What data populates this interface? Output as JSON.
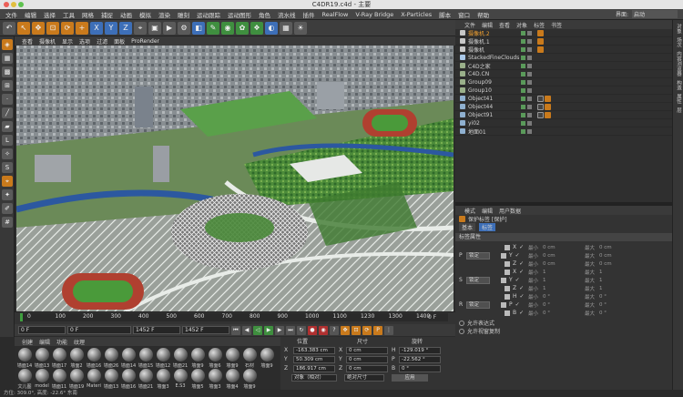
{
  "window": {
    "title": "C4DR19.c4d - 主要"
  },
  "menu": [
    "文件",
    "编辑",
    "选择",
    "工具",
    "网格",
    "捕捉",
    "动画",
    "模拟",
    "渲染",
    "雕刻",
    "运动跟踪",
    "运动图形",
    "角色",
    "流水线",
    "插件",
    "RealFlow",
    "V-Ray Bridge",
    "X-Particles",
    "脚本",
    "窗口",
    "帮助"
  ],
  "layout": {
    "label": "界面:",
    "value": "启动"
  },
  "viewport": {
    "menu": [
      "查看",
      "摄像机",
      "显示",
      "选项",
      "过滤",
      "面板",
      "ProRender"
    ]
  },
  "timeline": {
    "ticks": [
      "0",
      "100",
      "200",
      "300",
      "400",
      "500",
      "600",
      "700",
      "800",
      "900",
      "1000",
      "1100",
      "1230",
      "1300",
      "1400"
    ],
    "end_label": "0 F"
  },
  "transport": {
    "start": "0 F",
    "current": "0 F",
    "end1": "1452 F",
    "end2": "1452 F"
  },
  "materials": {
    "menu": [
      "创建",
      "编辑",
      "功能",
      "纹理"
    ],
    "items": [
      "墙面14",
      "墙面13",
      "墙面17",
      "墙面2",
      "墙面16",
      "墙面26",
      "墙面14",
      "墙面15",
      "墙面12",
      "墙面21",
      "墙面9",
      "墙面6",
      "墙面9",
      "石材",
      "墙面9",
      "文儿图",
      "model",
      "墙面11",
      "墙面19",
      "Materi",
      "墙面13",
      "墙面16",
      "墙面21",
      "墙面3",
      "E.S3",
      "墙面5",
      "墙面3",
      "墙面4",
      "墙面9"
    ]
  },
  "coords": {
    "headers": [
      "位置",
      "尺寸",
      "旋转"
    ],
    "rows": [
      {
        "axis": "X",
        "pos": "-163.383 cm",
        "size_axis": "X",
        "size": "0 cm",
        "rot_axis": "H",
        "rot": "-129.019 °"
      },
      {
        "axis": "Y",
        "pos": "50.309 cm",
        "size_axis": "Y",
        "size": "0 cm",
        "rot_axis": "P",
        "rot": "-22.562 °"
      },
      {
        "axis": "Z",
        "pos": "186.917 cm",
        "size_axis": "Z",
        "size": "0 cm",
        "rot_axis": "B",
        "rot": "0 °"
      }
    ],
    "mode1": "对象（相对）",
    "mode2": "绝对尺寸",
    "apply": "应用"
  },
  "status": "方位: 309.0°, 高度: -22.6° 东南",
  "om": {
    "tabs": [
      "文件",
      "编辑",
      "查看",
      "对象",
      "标签",
      "书签"
    ],
    "objects": [
      {
        "name": "摄像机.2",
        "icon": "camera",
        "hl": true
      },
      {
        "name": "摄像机.1",
        "icon": "camera",
        "hl": false
      },
      {
        "name": "摄像机",
        "icon": "camera",
        "hl": false
      },
      {
        "name": "StackedFineClouds",
        "icon": "cloud",
        "hl": false
      },
      {
        "name": "C4D之家",
        "icon": "null",
        "hl": false
      },
      {
        "name": "C4D.CN",
        "icon": "null",
        "hl": false
      },
      {
        "name": "Group09",
        "icon": "null",
        "hl": false
      },
      {
        "name": "Group10",
        "icon": "null",
        "hl": false
      },
      {
        "name": "Object41",
        "icon": "object",
        "hl": false
      },
      {
        "name": "Object44",
        "icon": "object",
        "hl": false
      },
      {
        "name": "Object91",
        "icon": "object",
        "hl": false
      },
      {
        "name": "yi02",
        "icon": "object",
        "hl": false
      },
      {
        "name": "地面01",
        "icon": "object",
        "hl": false
      }
    ]
  },
  "attr": {
    "tabs": [
      "模式",
      "编辑",
      "用户数据"
    ],
    "title": "保护标签 [保护]",
    "subtabs": [
      "基本",
      "标签"
    ],
    "section": "标签属性",
    "groups": [
      {
        "label": "P",
        "lock": "锁定",
        "rows": [
          {
            "a": "X",
            "min": "0 cm",
            "max": "0 cm"
          },
          {
            "a": "Y",
            "min": "0 cm",
            "max": "0 cm"
          },
          {
            "a": "Z",
            "min": "0 cm",
            "max": "0 cm"
          }
        ]
      },
      {
        "label": "S",
        "lock": "锁定",
        "rows": [
          {
            "a": "X",
            "min": "1",
            "max": "1"
          },
          {
            "a": "Y",
            "min": "1",
            "max": "1"
          },
          {
            "a": "Z",
            "min": "1",
            "max": "1"
          }
        ]
      },
      {
        "label": "R",
        "lock": "锁定",
        "rows": [
          {
            "a": "H",
            "min": "0 °",
            "max": "0 °"
          },
          {
            "a": "P",
            "min": "0 °",
            "max": "0 °"
          },
          {
            "a": "B",
            "min": "0 °",
            "max": "0 °"
          }
        ]
      }
    ],
    "min_label": "最小",
    "max_label": "最大",
    "allow_expr": "允许表达式",
    "allow_copy": "允许视窗复制"
  },
  "rightstrip": [
    "对象",
    "场次",
    "内容浏览器",
    "构造",
    "属性",
    "层"
  ]
}
